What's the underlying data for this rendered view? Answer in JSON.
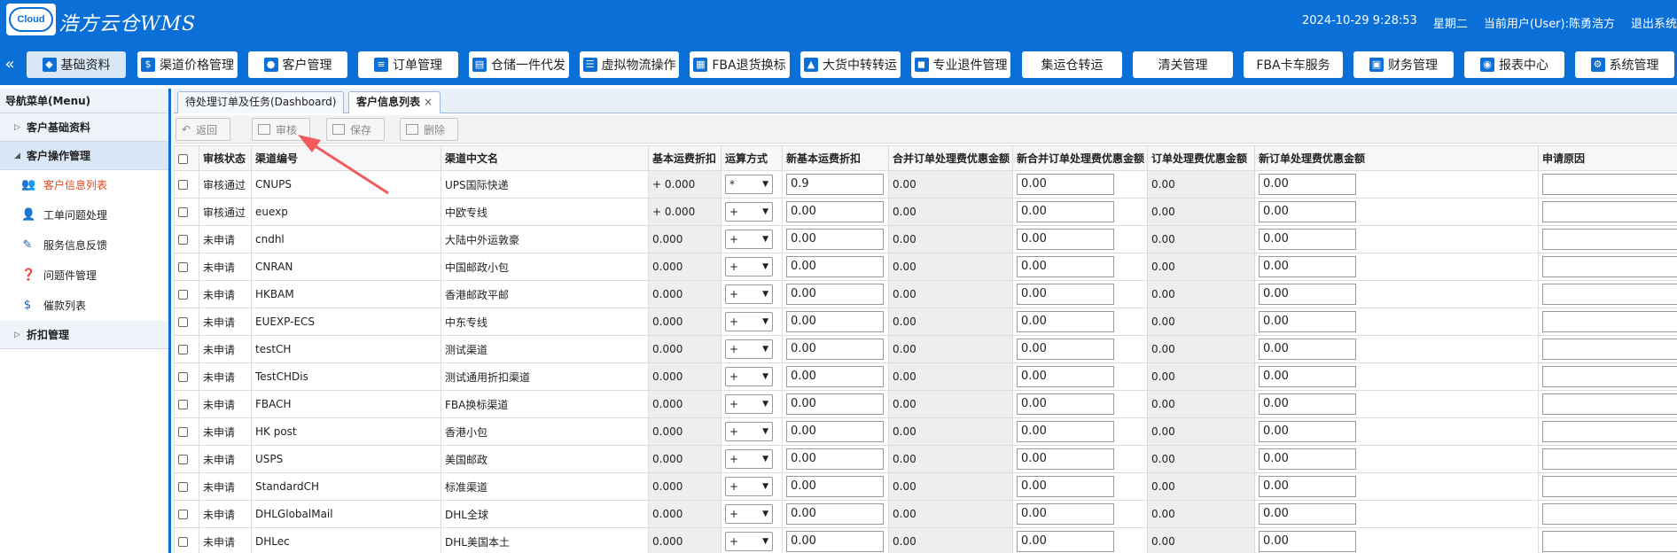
{
  "header": {
    "logo_text": "Cloud",
    "title": "浩方云仓WMS",
    "datetime": "2024-10-29 9:28:53",
    "weekday": "星期二",
    "user": "当前用户(User):陈勇浩方",
    "logout": "退出系统"
  },
  "nav": {
    "collapse": "«",
    "items": [
      {
        "label": "基础资料",
        "icon": "tag-icon"
      },
      {
        "label": "渠道价格管理",
        "icon": "price-icon"
      },
      {
        "label": "客户管理",
        "icon": "user-icon"
      },
      {
        "label": "订单管理",
        "icon": "order-icon"
      },
      {
        "label": "仓储一件代发",
        "icon": "warehouse-icon"
      },
      {
        "label": "虚拟物流操作",
        "icon": "list-icon"
      },
      {
        "label": "FBA退货换标",
        "icon": "fba-icon"
      },
      {
        "label": "大货中转转运",
        "icon": "truck-icon"
      },
      {
        "label": "专业退件管理",
        "icon": "car-icon"
      },
      {
        "label": "集运仓转运",
        "icon": ""
      },
      {
        "label": "清关管理",
        "icon": ""
      },
      {
        "label": "FBA卡车服务",
        "icon": ""
      },
      {
        "label": "财务管理",
        "icon": "finance-icon"
      },
      {
        "label": "报表中心",
        "icon": "database-icon"
      },
      {
        "label": "系统管理",
        "icon": "system-icon"
      }
    ]
  },
  "sidebar": {
    "title": "导航菜单(Menu)",
    "groups": [
      {
        "label": "客户基础资料"
      },
      {
        "label": "客户操作管理"
      },
      {
        "label": "折扣管理"
      }
    ],
    "items": [
      {
        "label": "客户信息列表"
      },
      {
        "label": "工单问题处理"
      },
      {
        "label": "服务信息反馈"
      },
      {
        "label": "问题件管理"
      },
      {
        "label": "催款列表"
      }
    ]
  },
  "tabs": [
    {
      "label": "待处理订单及任务(Dashboard)"
    },
    {
      "label": "客户信息列表",
      "close": "×"
    }
  ],
  "toolbar": {
    "back": "返回",
    "review": "审核",
    "save": "保存",
    "delete": "删除"
  },
  "table": {
    "headers": [
      "审核状态",
      "渠道编号",
      "渠道中文名",
      "基本运费折扣",
      "运算方式",
      "新基本运费折扣",
      "合并订单处理费优惠金额",
      "新合并订单处理费优惠金额",
      "订单处理费优惠金额",
      "新订单处理费优惠金额",
      "申请原因"
    ],
    "rows": [
      {
        "status": "审核通过",
        "code": "CNUPS",
        "name": "UPS国际快递",
        "discount": "+ 0.000",
        "op": "*",
        "new_discount": "0.9",
        "merge": "0.00",
        "new_merge": "0.00",
        "fee": "0.00",
        "new_fee": "0.00"
      },
      {
        "status": "审核通过",
        "code": "euexp",
        "name": "中欧专线",
        "discount": "+ 0.000",
        "op": "+",
        "new_discount": "0.00",
        "merge": "0.00",
        "new_merge": "0.00",
        "fee": "0.00",
        "new_fee": "0.00"
      },
      {
        "status": "未申请",
        "code": "cndhl",
        "name": "大陆中外运敦豪",
        "discount": "0.000",
        "op": "+",
        "new_discount": "0.00",
        "merge": "0.00",
        "new_merge": "0.00",
        "fee": "0.00",
        "new_fee": "0.00"
      },
      {
        "status": "未申请",
        "code": "CNRAN",
        "name": "中国邮政小包",
        "discount": "0.000",
        "op": "+",
        "new_discount": "0.00",
        "merge": "0.00",
        "new_merge": "0.00",
        "fee": "0.00",
        "new_fee": "0.00"
      },
      {
        "status": "未申请",
        "code": "HKBAM",
        "name": "香港邮政平邮",
        "discount": "0.000",
        "op": "+",
        "new_discount": "0.00",
        "merge": "0.00",
        "new_merge": "0.00",
        "fee": "0.00",
        "new_fee": "0.00"
      },
      {
        "status": "未申请",
        "code": "EUEXP-ECS",
        "name": "中东专线",
        "discount": "0.000",
        "op": "+",
        "new_discount": "0.00",
        "merge": "0.00",
        "new_merge": "0.00",
        "fee": "0.00",
        "new_fee": "0.00"
      },
      {
        "status": "未申请",
        "code": "testCH",
        "name": "测试渠道",
        "discount": "0.000",
        "op": "+",
        "new_discount": "0.00",
        "merge": "0.00",
        "new_merge": "0.00",
        "fee": "0.00",
        "new_fee": "0.00"
      },
      {
        "status": "未申请",
        "code": "TestCHDis",
        "name": "测试通用折扣渠道",
        "discount": "0.000",
        "op": "+",
        "new_discount": "0.00",
        "merge": "0.00",
        "new_merge": "0.00",
        "fee": "0.00",
        "new_fee": "0.00"
      },
      {
        "status": "未申请",
        "code": "FBACH",
        "name": "FBA换标渠道",
        "discount": "0.000",
        "op": "+",
        "new_discount": "0.00",
        "merge": "0.00",
        "new_merge": "0.00",
        "fee": "0.00",
        "new_fee": "0.00"
      },
      {
        "status": "未申请",
        "code": "HK post",
        "name": "香港小包",
        "discount": "0.000",
        "op": "+",
        "new_discount": "0.00",
        "merge": "0.00",
        "new_merge": "0.00",
        "fee": "0.00",
        "new_fee": "0.00"
      },
      {
        "status": "未申请",
        "code": "USPS",
        "name": "美国邮政",
        "discount": "0.000",
        "op": "+",
        "new_discount": "0.00",
        "merge": "0.00",
        "new_merge": "0.00",
        "fee": "0.00",
        "new_fee": "0.00"
      },
      {
        "status": "未申请",
        "code": "StandardCH",
        "name": "标准渠道",
        "discount": "0.000",
        "op": "+",
        "new_discount": "0.00",
        "merge": "0.00",
        "new_merge": "0.00",
        "fee": "0.00",
        "new_fee": "0.00"
      },
      {
        "status": "未申请",
        "code": "DHLGlobalMail",
        "name": "DHL全球",
        "discount": "0.000",
        "op": "+",
        "new_discount": "0.00",
        "merge": "0.00",
        "new_merge": "0.00",
        "fee": "0.00",
        "new_fee": "0.00"
      },
      {
        "status": "未申请",
        "code": "DHLec",
        "name": "DHL美国本土",
        "discount": "0.000",
        "op": "+",
        "new_discount": "0.00",
        "merge": "0.00",
        "new_merge": "0.00",
        "fee": "0.00",
        "new_fee": "0.00"
      }
    ]
  },
  "colors": {
    "brand": "#0b6fd8",
    "active_menu": "#e4481b",
    "annotation": "#f05a5a"
  }
}
